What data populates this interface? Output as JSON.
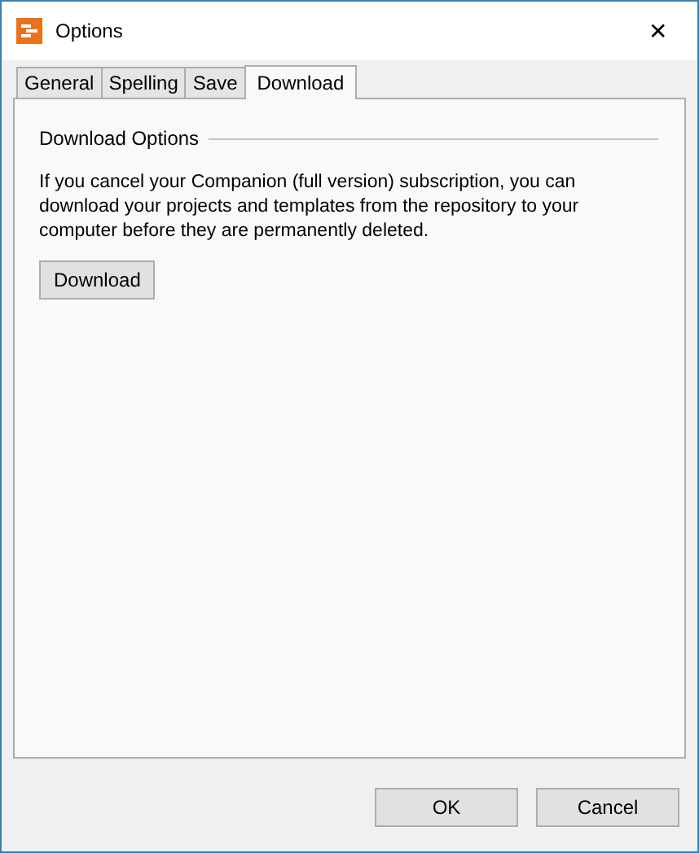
{
  "window": {
    "title": "Options",
    "close": "✕"
  },
  "tabs": [
    {
      "label": "General",
      "selected": false
    },
    {
      "label": "Spelling",
      "selected": false
    },
    {
      "label": "Save",
      "selected": false
    },
    {
      "label": "Download",
      "selected": true
    }
  ],
  "group": {
    "title": "Download Options",
    "text": "If you cancel your Companion (full version) subscription, you can download your projects and templates from the repository to your computer before they are permanently deleted.",
    "button": "Download"
  },
  "buttons": [
    "OK",
    "Cancel"
  ]
}
